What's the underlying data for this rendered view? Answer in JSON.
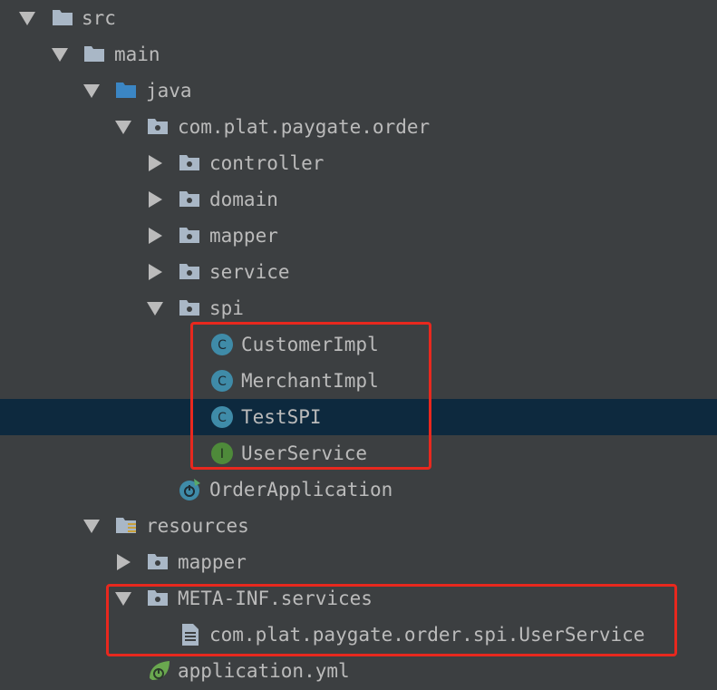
{
  "tree": {
    "src": "src",
    "main": "main",
    "java": "java",
    "package": "com.plat.paygate.order",
    "controller": "controller",
    "domain": "domain",
    "mapper": "mapper",
    "service": "service",
    "spi": "spi",
    "customer_impl": "CustomerImpl",
    "merchant_impl": "MerchantImpl",
    "test_spi": "TestSPI",
    "user_service": "UserService",
    "order_application": "OrderApplication",
    "resources": "resources",
    "res_mapper": "mapper",
    "meta_inf": "META-INF.services",
    "service_file": "com.plat.paygate.order.spi.UserService",
    "application_yml": "application.yml"
  },
  "icons": {
    "class_badge_letter": "C",
    "interface_badge_letter": "I",
    "folder": "folder-icon",
    "package": "package-folder-icon",
    "source_root": "source-root-folder-icon",
    "resources_root": "resources-root-folder-icon",
    "class": "class-icon",
    "interface": "interface-icon",
    "spring_boot_app": "spring-boot-app-icon",
    "text_file": "text-file-icon",
    "spring_yml": "spring-leaf-icon"
  },
  "colors": {
    "background": "#3c3f41",
    "selection": "#0d293e",
    "text": "#bbbbbb",
    "highlight_box": "#e8281e",
    "class_badge": "#3f8ba8",
    "interface_badge": "#4e8a3a",
    "source_root_folder": "#3b86c4",
    "folder": "#a9b7c6"
  }
}
